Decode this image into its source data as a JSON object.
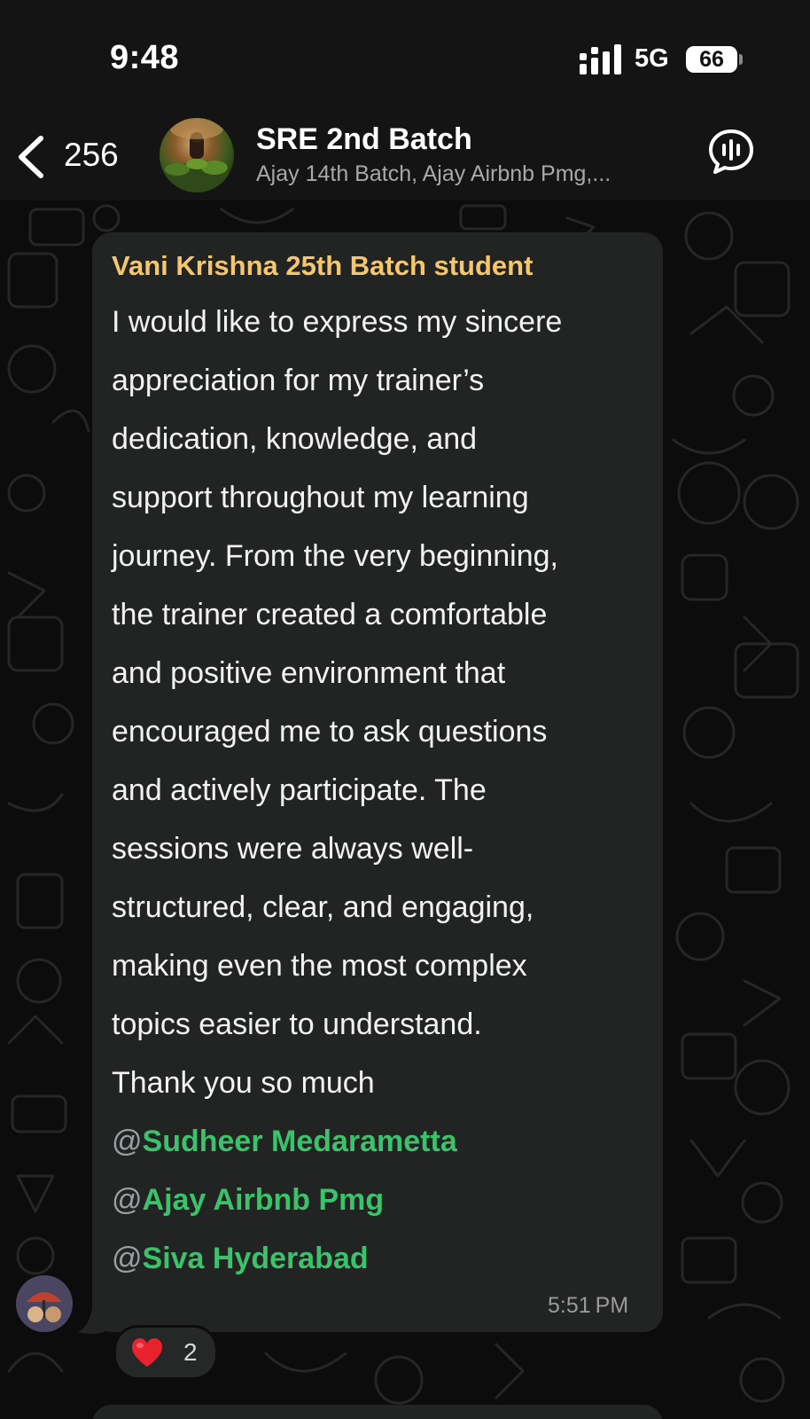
{
  "status_bar": {
    "time": "9:48",
    "network": "5G",
    "battery": "66"
  },
  "header": {
    "back_count": "256",
    "title": "SRE 2nd Batch",
    "subtitle": "Ajay 14th Batch, Ajay Airbnb Pmg,..."
  },
  "message": {
    "sender": "Vani Krishna 25th Batch student",
    "lines": [
      "I would like to express my sincere",
      "appreciation for my trainer’s",
      "dedication, knowledge, and",
      "support throughout my learning",
      "journey. From the very beginning,",
      "the trainer created a comfortable",
      "and positive environment that",
      "encouraged me to ask questions",
      "and actively participate. The",
      "sessions were always well-",
      "structured, clear, and engaging,",
      "making even the most complex",
      "topics easier to understand.",
      "Thank you so much"
    ],
    "mentions": [
      "Sudheer Medarametta",
      "Ajay Airbnb Pmg",
      "Siva Hyderabad"
    ],
    "mention_prefix": "@",
    "time": "5:51 PM",
    "reaction_count": "2"
  },
  "colors": {
    "sender_name": "#f4c76e",
    "mention": "#3cc26a",
    "bubble": "#222323",
    "background": "#0c0c0c"
  },
  "icons": {
    "back": "chevron-left-icon",
    "voice_chat": "voice-chat-icon",
    "reaction": "red-heart-emoji"
  }
}
